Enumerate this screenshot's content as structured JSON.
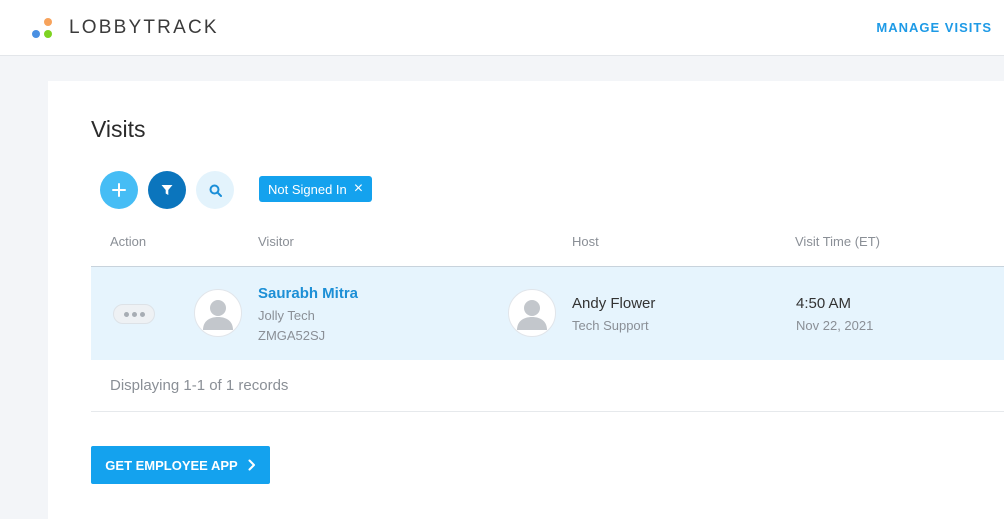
{
  "header": {
    "brand": "LOBBYTRACK",
    "nav_link": "MANAGE VISITS",
    "logo_colors": [
      "#f7a35c",
      "#4a90e2",
      "#7ed321",
      "#1ab0ef"
    ]
  },
  "page": {
    "title": "Visits"
  },
  "toolbar": {
    "add_icon": "plus-icon",
    "filter_icon": "filter-icon",
    "search_icon": "search-icon",
    "filter_chip": "Not Signed In",
    "chip_close": "×"
  },
  "table": {
    "columns": [
      "Action",
      "Visitor",
      "Host",
      "Visit Time (ET)"
    ],
    "rows": [
      {
        "visitor_name": "Saurabh Mitra",
        "visitor_company": "Jolly Tech",
        "visitor_code": "ZMGA52SJ",
        "host_name": "Andy Flower",
        "host_department": "Tech Support",
        "visit_time": "4:50 AM",
        "visit_date": "Nov 22, 2021"
      }
    ],
    "footer": "Displaying 1-1 of 1 records"
  },
  "actions": {
    "employee_app": "GET EMPLOYEE APP"
  },
  "colors": {
    "accent": "#14a2ee",
    "row_highlight": "#e6f4fd"
  }
}
